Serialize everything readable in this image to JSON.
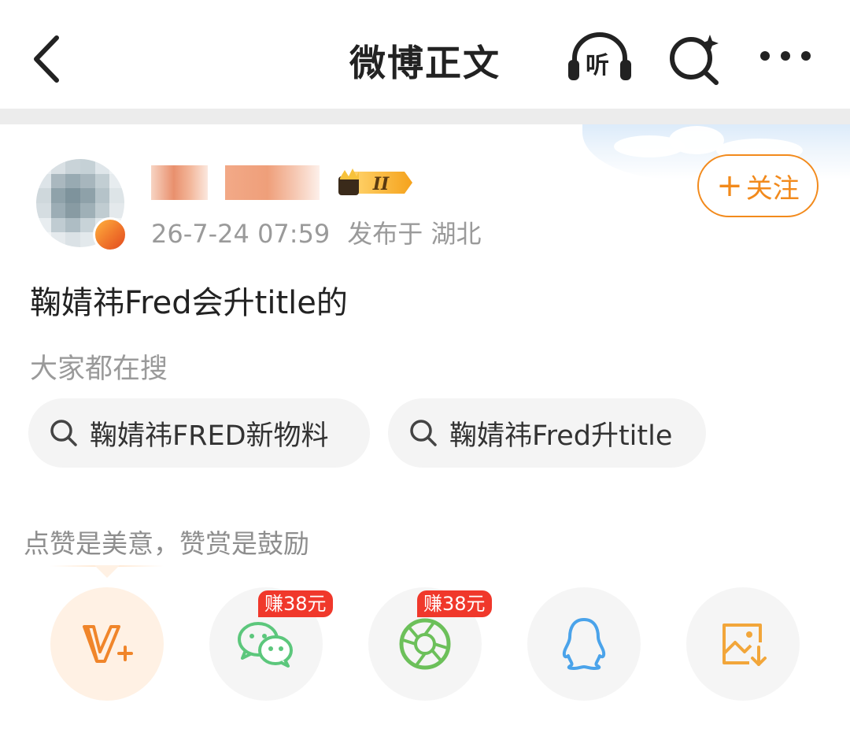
{
  "header": {
    "title": "微博正文",
    "listen_label": "听",
    "icons": [
      "back-arrow-icon",
      "listen-headphone-icon",
      "search-sparkle-icon",
      "more-dots-icon"
    ]
  },
  "post": {
    "timestamp": "26-7-24 07:59",
    "location": "发布于 湖北",
    "follow_label": "关注",
    "follow_plus": "+",
    "text": "鞠婧祎Fred会升title的",
    "level_badge": "II"
  },
  "search_section": {
    "label": "大家都在搜",
    "chips": [
      {
        "text": "鞠婧祎FRED新物料",
        "icon": "search-icon"
      },
      {
        "text": "鞠婧祎Fred升title",
        "icon": "search-icon"
      }
    ]
  },
  "share": {
    "tip": "点赞是美意，赞赏是鼓励",
    "buttons": [
      {
        "name": "v-plus",
        "icon": "v-plus-icon",
        "color": "#f0852a"
      },
      {
        "name": "wechat",
        "icon": "wechat-icon",
        "color": "#5cc77c",
        "badge": "赚38元"
      },
      {
        "name": "moments",
        "icon": "wechat-moments-icon",
        "color": "#6cc05a",
        "badge": "赚38元"
      },
      {
        "name": "qq",
        "icon": "qq-icon",
        "color": "#4aa3ea"
      },
      {
        "name": "save-image",
        "icon": "save-image-icon",
        "color": "#f2a63a"
      }
    ]
  },
  "colors": {
    "accent": "#f28a1c",
    "badge_red": "#f0382b",
    "muted_text": "#9a9a9a"
  }
}
